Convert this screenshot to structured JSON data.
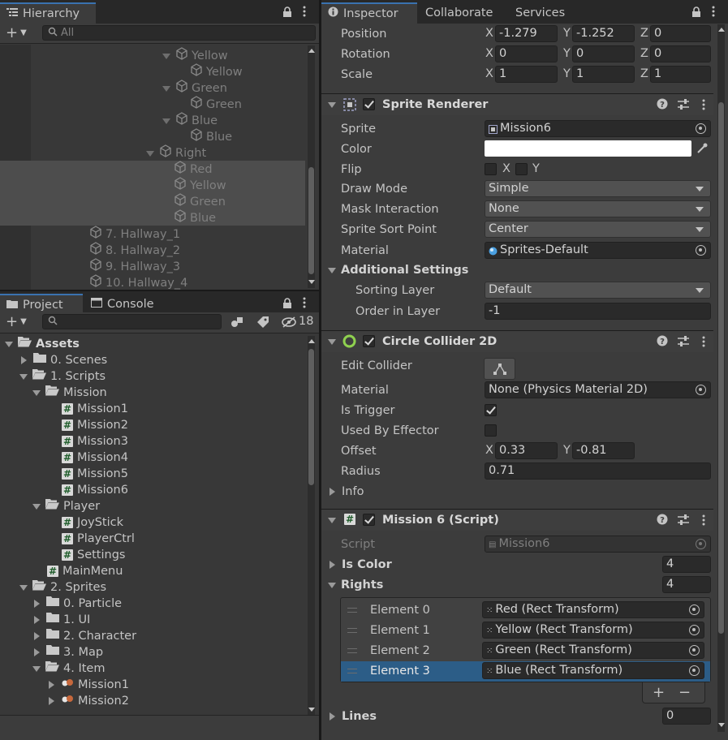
{
  "hierarchy": {
    "tab_label": "Hierarchy",
    "search_placeholder": "All",
    "rows": [
      {
        "label": "Yellow",
        "indent": 204,
        "icon": true,
        "expand": "down"
      },
      {
        "label": "Yellow",
        "indent": 234,
        "icon": true,
        "expand": "none"
      },
      {
        "label": "Green",
        "indent": 204,
        "icon": true,
        "expand": "down"
      },
      {
        "label": "Green",
        "indent": 234,
        "icon": true,
        "expand": "none"
      },
      {
        "label": "Blue",
        "indent": 204,
        "icon": true,
        "expand": "down"
      },
      {
        "label": "Blue",
        "indent": 234,
        "icon": true,
        "expand": "none"
      },
      {
        "label": "Right",
        "indent": 184,
        "icon": true,
        "expand": "down"
      },
      {
        "label": "Red",
        "indent": 214,
        "icon": true,
        "expand": "none"
      },
      {
        "label": "Yellow",
        "indent": 214,
        "icon": true,
        "expand": "none"
      },
      {
        "label": "Green",
        "indent": 214,
        "icon": true,
        "expand": "none"
      },
      {
        "label": "Blue",
        "indent": 214,
        "icon": true,
        "expand": "none"
      },
      {
        "label": "7. Hallway_1",
        "indent": 110,
        "icon": true,
        "expand": "none"
      },
      {
        "label": "8. Hallway_2",
        "indent": 110,
        "icon": true,
        "expand": "none"
      },
      {
        "label": "9. Hallway_3",
        "indent": 110,
        "icon": true,
        "expand": "none"
      },
      {
        "label": "10. Hallway_4",
        "indent": 110,
        "icon": true,
        "expand": "none"
      }
    ]
  },
  "project": {
    "tabs": [
      "Project",
      "Console"
    ],
    "hidden_count": "18",
    "rows": [
      {
        "label": "Assets",
        "indent": 6,
        "kind": "folder-open",
        "bold": true
      },
      {
        "label": "0. Scenes",
        "indent": 24,
        "kind": "folder",
        "expand": "right"
      },
      {
        "label": "1. Scripts",
        "indent": 24,
        "kind": "folder-open",
        "expand": "down"
      },
      {
        "label": "Mission",
        "indent": 40,
        "kind": "folder-open",
        "expand": "down"
      },
      {
        "label": "Mission1",
        "indent": 76,
        "kind": "script"
      },
      {
        "label": "Mission2",
        "indent": 76,
        "kind": "script"
      },
      {
        "label": "Mission3",
        "indent": 76,
        "kind": "script"
      },
      {
        "label": "Mission4",
        "indent": 76,
        "kind": "script"
      },
      {
        "label": "Mission5",
        "indent": 76,
        "kind": "script"
      },
      {
        "label": "Mission6",
        "indent": 76,
        "kind": "script"
      },
      {
        "label": "Player",
        "indent": 40,
        "kind": "folder-open",
        "expand": "down"
      },
      {
        "label": "JoyStick",
        "indent": 76,
        "kind": "script"
      },
      {
        "label": "PlayerCtrl",
        "indent": 76,
        "kind": "script"
      },
      {
        "label": "Settings",
        "indent": 76,
        "kind": "script"
      },
      {
        "label": "MainMenu",
        "indent": 58,
        "kind": "script"
      },
      {
        "label": "2. Sprites",
        "indent": 24,
        "kind": "folder-open",
        "expand": "down"
      },
      {
        "label": "0. Particle",
        "indent": 40,
        "kind": "folder",
        "expand": "right"
      },
      {
        "label": "1. UI",
        "indent": 40,
        "kind": "folder",
        "expand": "right"
      },
      {
        "label": "2. Character",
        "indent": 40,
        "kind": "folder",
        "expand": "right"
      },
      {
        "label": "3. Map",
        "indent": 40,
        "kind": "folder",
        "expand": "right"
      },
      {
        "label": "4. Item",
        "indent": 40,
        "kind": "folder-open",
        "expand": "down"
      },
      {
        "label": "Mission1",
        "indent": 58,
        "kind": "sprite",
        "expand": "right"
      },
      {
        "label": "Mission2",
        "indent": 58,
        "kind": "sprite",
        "expand": "right"
      }
    ]
  },
  "inspector": {
    "tabs": [
      "Inspector",
      "Collaborate",
      "Services"
    ],
    "transform": {
      "position": {
        "label": "Position",
        "x": "-1.279",
        "y": "-1.252",
        "z": "0"
      },
      "rotation": {
        "label": "Rotation",
        "x": "0",
        "y": "0",
        "z": "0"
      },
      "scale": {
        "label": "Scale",
        "x": "1",
        "y": "1",
        "z": "1"
      },
      "axis_x": "X",
      "axis_y": "Y",
      "axis_z": "Z"
    },
    "sprite_renderer": {
      "title": "Sprite Renderer",
      "sprite_label": "Sprite",
      "sprite_value": "Mission6",
      "color_label": "Color",
      "color_value": "#ffffff",
      "flip_label": "Flip",
      "flip_x": "X",
      "flip_y": "Y",
      "draw_mode_label": "Draw Mode",
      "draw_mode_value": "Simple",
      "mask_label": "Mask Interaction",
      "mask_value": "None",
      "sort_point_label": "Sprite Sort Point",
      "sort_point_value": "Center",
      "material_label": "Material",
      "material_value": "Sprites-Default",
      "additional_label": "Additional Settings",
      "sorting_layer_label": "Sorting Layer",
      "sorting_layer_value": "Default",
      "order_label": "Order in Layer",
      "order_value": "-1"
    },
    "circle_collider": {
      "title": "Circle Collider 2D",
      "edit_label": "Edit Collider",
      "material_label": "Material",
      "material_value": "None (Physics Material 2D)",
      "trigger_label": "Is Trigger",
      "effector_label": "Used By Effector",
      "offset_label": "Offset",
      "offset_x": "0.33",
      "offset_y": "-0.81",
      "radius_label": "Radius",
      "radius_value": "0.71",
      "info_label": "Info"
    },
    "mission_script": {
      "title": "Mission 6 (Script)",
      "script_label": "Script",
      "script_value": "Mission6",
      "is_color_label": "Is Color",
      "is_color_value": "4",
      "rights_label": "Rights",
      "rights_value": "4",
      "elements": [
        {
          "label": "Element 0",
          "value": "Red (Rect Transform)"
        },
        {
          "label": "Element 1",
          "value": "Yellow (Rect Transform)"
        },
        {
          "label": "Element 2",
          "value": "Green (Rect Transform)"
        },
        {
          "label": "Element 3",
          "value": "Blue (Rect Transform)"
        }
      ],
      "lines_label": "Lines",
      "lines_value": "0"
    },
    "accent_color": "#2c5d87"
  }
}
